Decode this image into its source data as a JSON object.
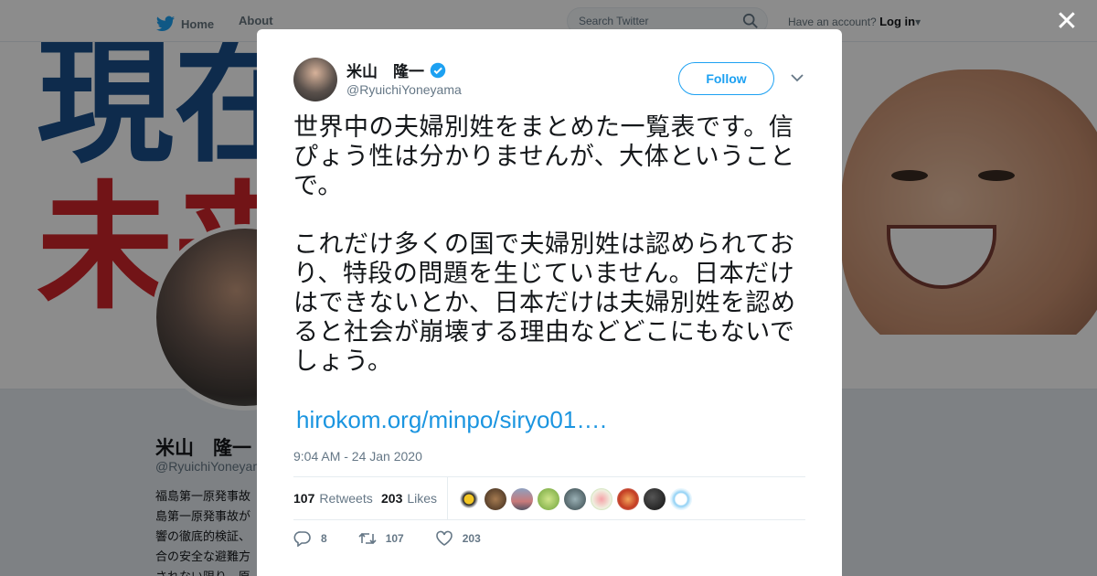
{
  "topbar": {
    "home_label": "Home",
    "about_label": "About",
    "search_placeholder": "Search Twitter",
    "account_text": "Have an account?",
    "login_label": "Log in"
  },
  "banner": {
    "line1": "現在",
    "line2": "未来"
  },
  "profile": {
    "name": "米山　隆一",
    "handle": "@RyuichiYoneyama",
    "bio": "福島第一原発事故 島第一原発事故が 響の徹底的検証、 合の安全な避難方 されない限り、原"
  },
  "tweet": {
    "author_name": "米山　隆一",
    "author_handle": "@RyuichiYoneyama",
    "follow_label": "Follow",
    "text": "世界中の夫婦別姓をまとめた一覧表です。信ぴょう性は分かりませんが、大体ということで。\n\nこれだけ多くの国で夫婦別姓は認められており、特段の問題を生じていません。日本だけはできないとか、日本だけは夫婦別姓を認めると社会が崩壊する理由などどこにもないでしょう。",
    "link": "hirokom.org/minpo/siryo01….",
    "timestamp": "9:04 AM - 24 Jan 2020",
    "retweets_count": "107",
    "retweets_label": "Retweets",
    "likes_count": "203",
    "likes_label": "Likes",
    "reply_count": "8",
    "retweet_action_count": "107",
    "like_action_count": "203"
  },
  "close_symbol": "✕",
  "colors": {
    "accent": "#1da1f2",
    "link": "#1b95e0",
    "banner_blue": "#1a4f8a",
    "banner_red": "#d0262b"
  }
}
